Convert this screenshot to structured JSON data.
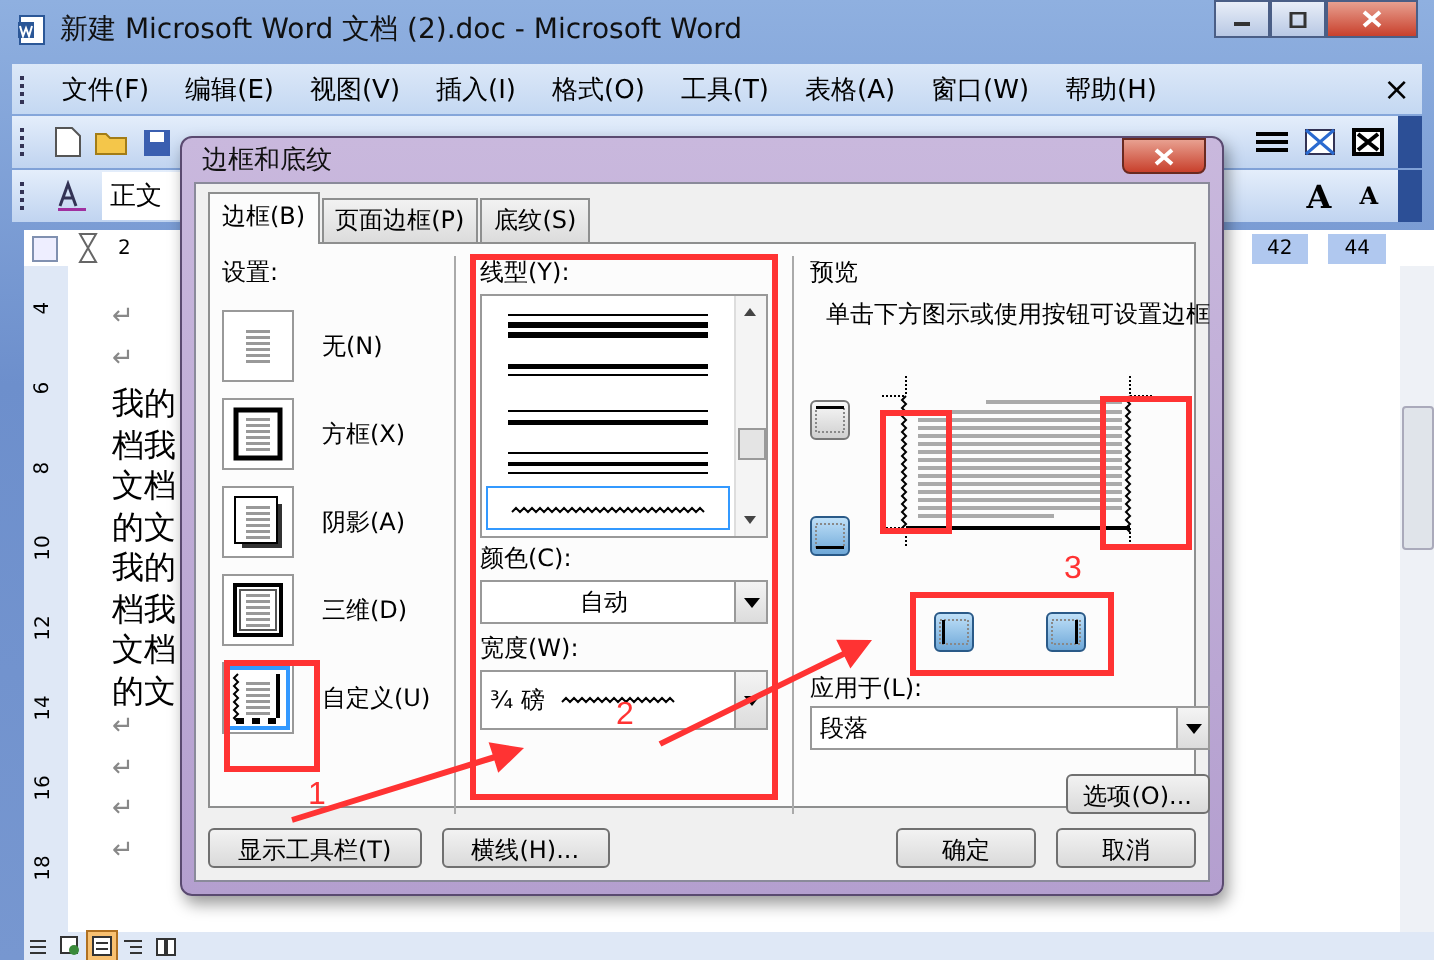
{
  "window": {
    "title": "新建 Microsoft Word 文档 (2).doc - Microsoft Word"
  },
  "menu": [
    {
      "label": "文件(F)"
    },
    {
      "label": "编辑(E)"
    },
    {
      "label": "视图(V)"
    },
    {
      "label": "插入(I)"
    },
    {
      "label": "格式(O)"
    },
    {
      "label": "工具(T)"
    },
    {
      "label": "表格(A)"
    },
    {
      "label": "窗口(W)"
    },
    {
      "label": "帮助(H)"
    }
  ],
  "menu_close": "×",
  "style_box": {
    "value": "正文"
  },
  "font_size_buttons": [
    "A",
    "A"
  ],
  "ruler": {
    "marks": [
      "2",
      "42",
      "44"
    ]
  },
  "vertical_ruler": [
    "4",
    "6",
    "8",
    "10",
    "12",
    "14",
    "16",
    "18"
  ],
  "document": {
    "paragraphs": [
      {
        "kind": "mark",
        "text": "↵"
      },
      {
        "kind": "mark",
        "text": "↵"
      },
      {
        "kind": "text",
        "text": "我的"
      },
      {
        "kind": "text",
        "text": "档我"
      },
      {
        "kind": "text",
        "text": "文档"
      },
      {
        "kind": "text",
        "text": "的文"
      },
      {
        "kind": "text",
        "text": "我的"
      },
      {
        "kind": "text",
        "text": "档我"
      },
      {
        "kind": "text",
        "text": "文档"
      },
      {
        "kind": "text",
        "text": "的文"
      },
      {
        "kind": "mark",
        "text": "↵"
      },
      {
        "kind": "mark",
        "text": "↵"
      },
      {
        "kind": "mark",
        "text": "↵"
      },
      {
        "kind": "mark",
        "text": "↵"
      }
    ]
  },
  "view_buttons": [
    {
      "kind": "normal",
      "selected": false
    },
    {
      "kind": "web",
      "selected": false
    },
    {
      "kind": "page",
      "selected": true
    },
    {
      "kind": "outline",
      "selected": false
    },
    {
      "kind": "reading",
      "selected": false
    }
  ],
  "dialog": {
    "title": "边框和底纹",
    "tabs": [
      {
        "label": "边框(B)",
        "selected": true
      },
      {
        "label": "页面边框(P)",
        "selected": false
      },
      {
        "label": "底纹(S)",
        "selected": false
      }
    ],
    "settings_label": "设置:",
    "settings": [
      {
        "kind": "none",
        "label": "无(N)",
        "selected": false
      },
      {
        "kind": "box",
        "label": "方框(X)",
        "selected": false
      },
      {
        "kind": "shadow",
        "label": "阴影(A)",
        "selected": false
      },
      {
        "kind": "threed",
        "label": "三维(D)",
        "selected": false
      },
      {
        "kind": "custom",
        "label": "自定义(U)",
        "selected": true
      }
    ],
    "line_style": {
      "label": "线型(Y):",
      "styles": [
        {
          "kind": "triple",
          "selected": false
        },
        {
          "kind": "thick-thin",
          "selected": false
        },
        {
          "kind": "thin-thick",
          "selected": false
        },
        {
          "kind": "thin-thick-thin",
          "selected": false
        },
        {
          "kind": "wave",
          "selected": true
        }
      ]
    },
    "color": {
      "label": "颜色(C):",
      "value": "自动"
    },
    "width": {
      "label": "宽度(W):",
      "value": "¾ 磅"
    },
    "preview": {
      "label": "预览",
      "hint": "单击下方图示或使用按钮可设置边框",
      "borders": [
        {
          "kind": "top",
          "on": false
        },
        {
          "kind": "bottom",
          "on": true
        },
        {
          "kind": "left",
          "on": true
        },
        {
          "kind": "right",
          "on": true
        }
      ]
    },
    "apply_to": {
      "label": "应用于(L):",
      "value": "段落"
    },
    "options_button": "选项(O)...",
    "buttons": [
      {
        "label": "显示工具栏(T)"
      },
      {
        "label": "横线(H)..."
      },
      {
        "label": "确定"
      },
      {
        "label": "取消"
      }
    ]
  },
  "annotation_numbers": [
    "1",
    "2",
    "3"
  ]
}
